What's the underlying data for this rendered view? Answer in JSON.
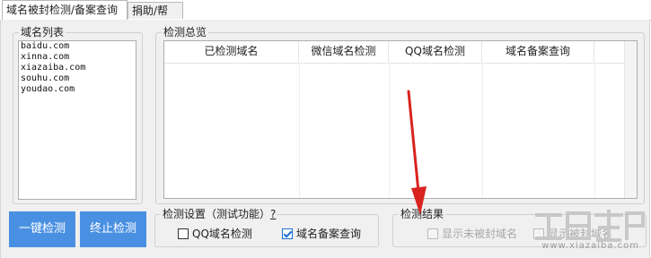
{
  "tabs": [
    {
      "label": "域名被封检测/备案查询"
    },
    {
      "label": "捐助/帮助"
    }
  ],
  "domain_list": {
    "title": "域名列表",
    "items": [
      "baidu.com",
      "xinna.com",
      "xiazaiba.com",
      "souhu.com",
      "youdao.com"
    ]
  },
  "overview": {
    "title": "检测总览",
    "columns": [
      "已检测域名",
      "微信域名检测",
      "QQ域名检测",
      "域名备案查询"
    ]
  },
  "buttons": {
    "start": "一键检测",
    "stop": "终止检测"
  },
  "settings": {
    "title": "检测设置（测试功能）",
    "help": "?",
    "options": [
      {
        "label": "QQ域名检测",
        "checked": false
      },
      {
        "label": "域名备案查询",
        "checked": true
      }
    ]
  },
  "results": {
    "title": "检测结果",
    "options": [
      {
        "label": "显示未被封域名",
        "enabled": false
      },
      {
        "label": "显示被封域名",
        "enabled": false
      }
    ]
  },
  "watermark": {
    "text": "www.xiazaiba.com"
  },
  "colors": {
    "accent": "#4a90e2",
    "arrow": "#d9231e"
  }
}
